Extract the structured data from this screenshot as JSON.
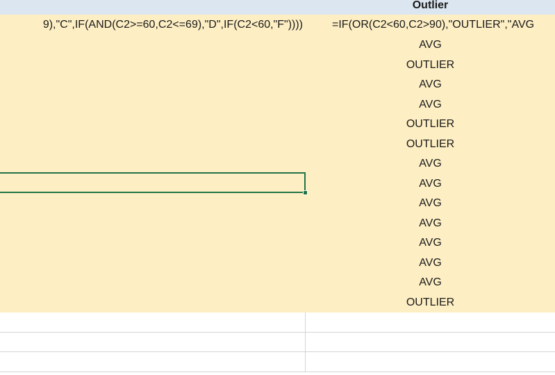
{
  "header": {
    "outlier_label": "Outlier"
  },
  "row2": {
    "grade_formula": "9),\"C\",IF(AND(C2>=60,C2<=69),\"D\",IF(C2<60,\"F\"))))",
    "outlier_formula": "=IF(OR(C2<60,C2>90),\"OUTLIER\",\"AVG"
  },
  "outlier_values": [
    "AVG",
    "OUTLIER",
    "AVG",
    "AVG",
    "OUTLIER",
    "OUTLIER",
    "AVG",
    "AVG",
    "AVG",
    "AVG",
    "AVG",
    "AVG",
    "AVG",
    "OUTLIER"
  ],
  "colors": {
    "header_fill": "#dce6f1",
    "data_fill": "#fdeec3",
    "selection": "#217346",
    "gridline": "#d4d4d4"
  }
}
